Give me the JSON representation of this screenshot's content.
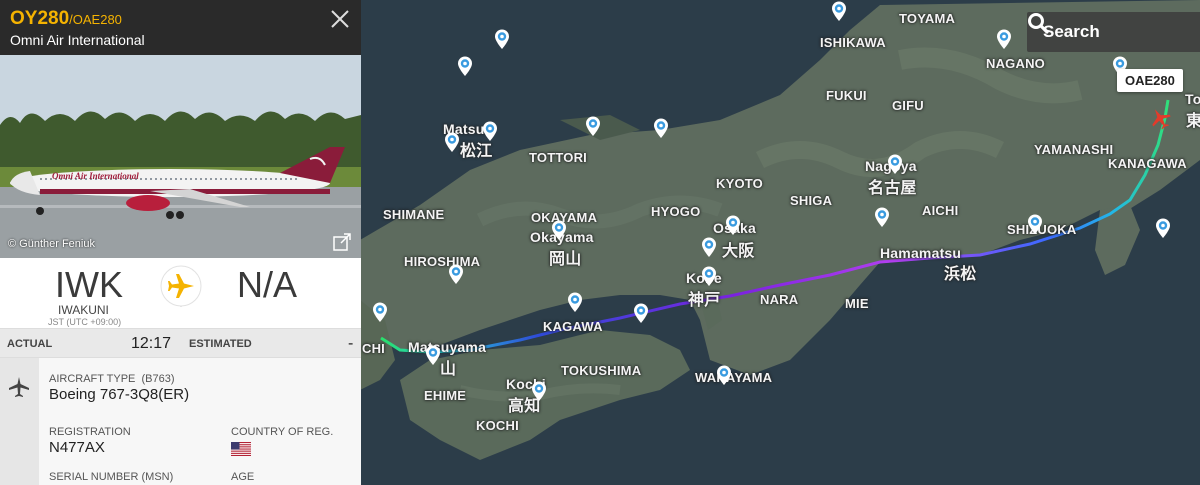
{
  "flight": {
    "number": "OY280",
    "callsign": "/OAE280",
    "airline": "Omni Air International",
    "photo_credit": "© Günther Feniuk",
    "photo_livery_text": "Omni Air International"
  },
  "route": {
    "origin_code": "IWK",
    "origin_name": "IWAKUNI",
    "origin_tz": "JST (UTC +09:00)",
    "dest_code": "N/A"
  },
  "times": {
    "actual_label": "ACTUAL",
    "actual_value": "12:17",
    "estimated_label": "ESTIMATED",
    "estimated_value": "-"
  },
  "aircraft": {
    "type_label": "AIRCRAFT TYPE",
    "type_code": "(B763)",
    "type_value": "Boeing 767-3Q8(ER)",
    "registration_label": "REGISTRATION",
    "registration_value": "N477AX",
    "country_label": "COUNTRY OF REG.",
    "serial_label": "SERIAL NUMBER (MSN)",
    "age_label": "AGE",
    "country_flag": "us-flag-icon"
  },
  "map": {
    "search_label": "Search",
    "callsign_tag": "OAE280",
    "labels": {
      "toyama": "TOYAMA",
      "ishikawa": "ISHIKAWA",
      "nagano": "NAGANO",
      "fukui": "FUKUI",
      "gifu": "GIFU",
      "yamanashi": "YAMANASHI",
      "kanagawa": "KANAGAWA",
      "tokyo_jp": "東",
      "tokyo_t": "To",
      "kyoto": "KYOTO",
      "shiga": "SHIGA",
      "aichi": "AICHI",
      "shizuoka": "SHIZUOKA",
      "nagoya": "Nagoya",
      "nagoya_jp": "名古屋",
      "hamamatsu": "Hamamatsu",
      "hamamatsu_jp": "浜松",
      "tottori": "TOTTORI",
      "matsue": "Matsue",
      "matsue_jp": "松江",
      "shimane": "SHIMANE",
      "okayama_pref": "OKAYAMA",
      "okayama": "Okayama",
      "okayama_jp": "岡山",
      "hyogo": "HYOGO",
      "osaka": "Osaka",
      "osaka_jp": "大阪",
      "kobe": "Kobe",
      "kobe_jp": "神戸",
      "hiroshima": "HIROSHIMA",
      "nara": "NARA",
      "mie": "MIE",
      "kagawa": "KAGAWA",
      "matsuyama": "Matsuyama",
      "matsuyama_jp": "山",
      "tokushima": "TOKUSHIMA",
      "wakayama": "WAKAYAMA",
      "ehime": "EHIME",
      "kochi": "Kochi",
      "kochi_jp": "高知",
      "kochi_pref": "KOCHI",
      "chi": "CHI"
    }
  },
  "colors": {
    "accent": "#f5b301",
    "header_bg": "#2a2a2a",
    "track_start": "#2ee86b",
    "track_mid": "#9b2bf0",
    "track_end": "#3a8bff"
  }
}
